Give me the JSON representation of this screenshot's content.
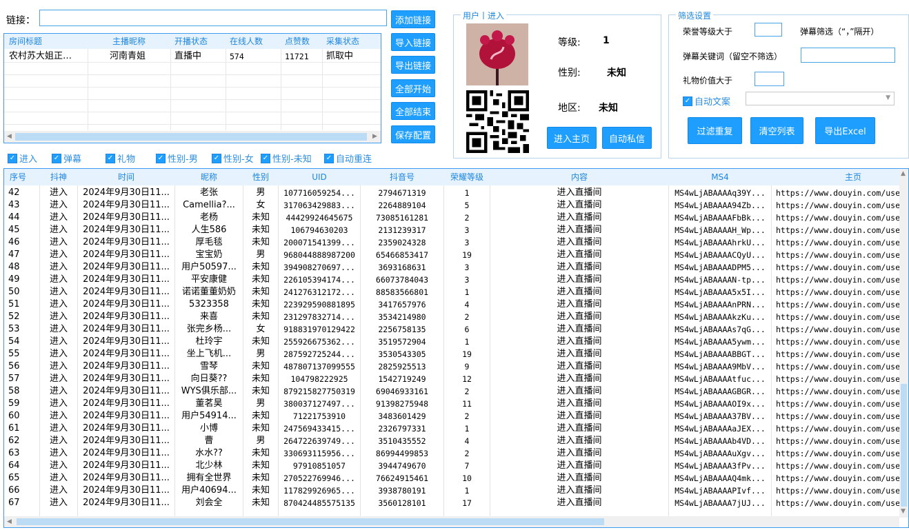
{
  "link": {
    "label": "链接：",
    "value": ""
  },
  "buttons": {
    "add_link": "添加链接",
    "import_link": "导入链接",
    "export_link": "导出链接",
    "start_all": "全部开始",
    "stop_all": "全部结束",
    "save_config": "保存配置",
    "enter_home": "进入主页",
    "auto_dm": "自动私信",
    "filter_dup": "过滤重复",
    "clear_list": "清空列表",
    "export_excel": "导出Excel"
  },
  "room_table": {
    "headers": [
      "房间标题",
      "主播昵称",
      "开播状态",
      "在线人数",
      "点赞数",
      "采集状态"
    ],
    "rows": [
      [
        "农村苏大姐正…",
        "河南青姐",
        "直播中",
        "574",
        "11721",
        "抓取中"
      ]
    ]
  },
  "user_panel": {
    "title": "用户丨进入",
    "level_label": "等级:",
    "level_value": "1",
    "gender_label": "性别:",
    "gender_value": "未知",
    "region_label": "地区:",
    "region_value": "未知"
  },
  "filter_panel": {
    "title": "筛选设置",
    "honor_level_label": "荣誉等级大于",
    "honor_level_value": "",
    "danmu_filter_label": "弹幕筛选（“，”隔开）",
    "danmu_keyword_label": "弹幕关键词（留空不筛选）",
    "danmu_keyword_value": "",
    "gift_value_label": "礼物价值大于",
    "gift_value_value": "",
    "auto_text_label": "自动文案",
    "auto_text_value": ""
  },
  "checkboxes": [
    {
      "label": "进入",
      "checked": true
    },
    {
      "label": "弹幕",
      "checked": true
    },
    {
      "label": "礼物",
      "checked": true
    },
    {
      "label": "性别-男",
      "checked": true
    },
    {
      "label": "性别-女",
      "checked": true
    },
    {
      "label": "性别-未知",
      "checked": true
    },
    {
      "label": "自动重连",
      "checked": true
    }
  ],
  "main_table": {
    "headers": [
      "序号",
      "抖神",
      "时间",
      "昵称",
      "性别",
      "UID",
      "抖音号",
      "荣耀等级",
      "内容",
      "MS4",
      "主页"
    ],
    "rows": [
      [
        "42",
        "进入",
        "2024年9月30日11...",
        "老张",
        "男",
        "10771605925​4...",
        "2794671319",
        "1",
        "进入直播间",
        "MS4wLjABAAAAq39Y...",
        "https://www.douyin.com/use"
      ],
      [
        "43",
        "进入",
        "2024年9月30日11...",
        "Camellia?...",
        "女",
        "317063429883...",
        "2264889104",
        "5",
        "进入直播间",
        "MS4wLjABAAAA94Zb...",
        "https://www.douyin.com/use"
      ],
      [
        "44",
        "进入",
        "2024年9月30日11...",
        "老杨",
        "未知",
        "44429924645675",
        "73085161281",
        "2",
        "进入直播间",
        "MS4wLjABAAAAFbBk...",
        "https://www.douyin.com/use"
      ],
      [
        "45",
        "进入",
        "2024年9月30日11...",
        "人生586",
        "未知",
        "106794630203",
        "2131239317",
        "3",
        "进入直播间",
        "MS4wLjABAAAAH_Wp...",
        "https://www.douyin.com/use"
      ],
      [
        "46",
        "进入",
        "2024年9月30日11...",
        "厚毛毯",
        "未知",
        "200071541399...",
        "2359024328",
        "3",
        "进入直播间",
        "MS4wLjABAAAAhrkU...",
        "https://www.douyin.com/use"
      ],
      [
        "47",
        "进入",
        "2024年9月30日11...",
        "宝宝奶",
        "男",
        "968044888987200",
        "65466853417",
        "19",
        "进入直播间",
        "MS4wLjABAAAACQyU...",
        "https://www.douyin.com/use"
      ],
      [
        "48",
        "进入",
        "2024年9月30日11...",
        "用户50597...",
        "未知",
        "394908270697...",
        "3693168631",
        "3",
        "进入直播间",
        "MS4wLjABAAAADPM5...",
        "https://www.douyin.com/use"
      ],
      [
        "49",
        "进入",
        "2024年9月30日11...",
        "平安康健",
        "未知",
        "226105394174...",
        "66073784043",
        "3",
        "进入直播间",
        "MS4wLjABAAAAN-tp...",
        "https://www.douyin.com/use"
      ],
      [
        "50",
        "进入",
        "2024年9月30日11...",
        "诺诺董董奶奶",
        "未知",
        "241276312172...",
        "88583566801",
        "1",
        "进入直播间",
        "MS4wLjABAAAA5x5I...",
        "https://www.douyin.com/use"
      ],
      [
        "51",
        "进入",
        "2024年9月30日11...",
        "5323358",
        "未知",
        "223929590881895",
        "3417657976",
        "4",
        "进入直播间",
        "MS4wLjABAAAAnPRN...",
        "https://www.douyin.com/use"
      ],
      [
        "52",
        "进入",
        "2024年9月30日11...",
        "来喜",
        "未知",
        "231297832714...",
        "3534214980",
        "2",
        "进入直播间",
        "MS4wLjABAAAAkzKu...",
        "https://www.douyin.com/use"
      ],
      [
        "53",
        "进入",
        "2024年9月30日11...",
        "张完乡杨...",
        "女",
        "918831970129422",
        "2256758135",
        "6",
        "进入直播间",
        "MS4wLjABAAAAs7qG...",
        "https://www.douyin.com/use"
      ],
      [
        "54",
        "进入",
        "2024年9月30日11...",
        "杜玲宇",
        "未知",
        "255926675362...",
        "3519572904",
        "1",
        "进入直播间",
        "MS4wLjABAAAA5ywm...",
        "https://www.douyin.com/use"
      ],
      [
        "55",
        "进入",
        "2024年9月30日11...",
        "坐上飞机...",
        "男",
        "287592725244...",
        "3530543305",
        "19",
        "进入直播间",
        "MS4wLjABAAAABBGT...",
        "https://www.douyin.com/use"
      ],
      [
        "56",
        "进入",
        "2024年9月30日11...",
        "雪琴",
        "未知",
        "487807137099555",
        "2825925513",
        "9",
        "进入直播间",
        "MS4wLjABAAAA9MbV...",
        "https://www.douyin.com/use"
      ],
      [
        "57",
        "进入",
        "2024年9月30日11...",
        "向日葵??",
        "未知",
        "104798222925",
        "1542719249",
        "12",
        "进入直播间",
        "MS4wLjABAAAAtfuc...",
        "https://www.douyin.com/use"
      ],
      [
        "58",
        "进入",
        "2024年9月30日11...",
        "WYS俱乐部...",
        "未知",
        "879215827750319",
        "69046933161",
        "2",
        "进入直播间",
        "MS4wLjABAAAAGBGR...",
        "https://www.douyin.com/use"
      ],
      [
        "59",
        "进入",
        "2024年9月30日11...",
        "董茗昊",
        "男",
        "380037127497...",
        "91398275948",
        "11",
        "进入直播间",
        "MS4wLjABAAAAOI9x...",
        "https://www.douyin.com/use"
      ],
      [
        "60",
        "进入",
        "2024年9月30日11...",
        "用户54914...",
        "未知",
        "71221753910",
        "3483601429",
        "2",
        "进入直播间",
        "MS4wLjABAAAA37BV...",
        "https://www.douyin.com/use"
      ],
      [
        "61",
        "进入",
        "2024年9月30日11...",
        "小博",
        "未知",
        "247569433415...",
        "2326797331",
        "1",
        "进入直播间",
        "MS4wLjABAAAAaJEX...",
        "https://www.douyin.com/use"
      ],
      [
        "62",
        "进入",
        "2024年9月30日11...",
        "曹",
        "男",
        "264722639749...",
        "3510435552",
        "4",
        "进入直播间",
        "MS4wLjABAAAAb4VD...",
        "https://www.douyin.com/use"
      ],
      [
        "63",
        "进入",
        "2024年9月30日11...",
        "水水??",
        "未知",
        "330693115956...",
        "86994499853",
        "2",
        "进入直播间",
        "MS4wLjABAAAAuXgv...",
        "https://www.douyin.com/use"
      ],
      [
        "64",
        "进入",
        "2024年9月30日11...",
        "北少林",
        "未知",
        "97910851057",
        "3944749670",
        "7",
        "进入直播间",
        "MS4wLjABAAAA3fPv...",
        "https://www.douyin.com/use"
      ],
      [
        "65",
        "进入",
        "2024年9月30日11...",
        "拥有全世界",
        "未知",
        "270522769946...",
        "76624915461",
        "10",
        "进入直播间",
        "MS4wLjABAAAAQ4mk...",
        "https://www.douyin.com/use"
      ],
      [
        "66",
        "进入",
        "2024年9月30日11...",
        "用户40694...",
        "未知",
        "117829926965...",
        "3938780191",
        "1",
        "进入直播间",
        "MS4wLjABAAAAPIvf...",
        "https://www.douyin.com/use"
      ],
      [
        "67",
        "进入",
        "2024年9月30日11...",
        "刘会全",
        "未知",
        "870424485575135",
        "3560128101",
        "17",
        "进入直播间",
        "MS4wLjABAAAA7jUJ...",
        "https://www.douyin.com/use"
      ]
    ]
  },
  "colors": {
    "accent": "#1e9fff",
    "header_bg": "#e6f2fd",
    "title_blue": "#1e86e0"
  },
  "icons": {
    "avatar": "avatar-image",
    "qr": "qr-code-image"
  }
}
